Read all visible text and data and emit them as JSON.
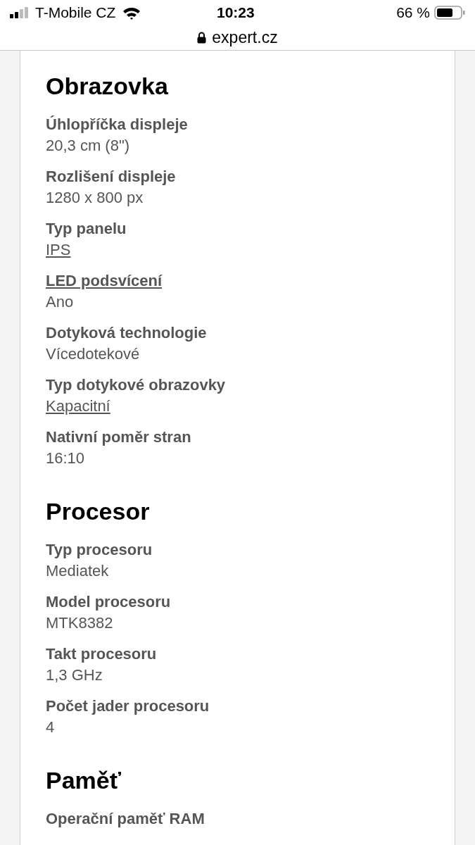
{
  "status_bar": {
    "carrier": "T-Mobile CZ",
    "time": "10:23",
    "battery": "66 %"
  },
  "address_bar": {
    "url": "expert.cz"
  },
  "sections": [
    {
      "title": "Obrazovka",
      "specs": [
        {
          "label": "Úhlopříčka displeje",
          "value": "20,3 cm (8\")",
          "label_link": false,
          "value_link": false
        },
        {
          "label": "Rozlišení displeje",
          "value": "1280 x 800 px",
          "label_link": false,
          "value_link": false
        },
        {
          "label": "Typ panelu",
          "value": "IPS",
          "label_link": false,
          "value_link": true
        },
        {
          "label": "LED podsvícení",
          "value": "Ano",
          "label_link": true,
          "value_link": false
        },
        {
          "label": "Dotyková technologie",
          "value": "Vícedotekové",
          "label_link": false,
          "value_link": false
        },
        {
          "label": "Typ dotykové obrazovky",
          "value": "Kapacitní",
          "label_link": false,
          "value_link": true
        },
        {
          "label": "Nativní poměr stran",
          "value": "16:10",
          "label_link": false,
          "value_link": false
        }
      ]
    },
    {
      "title": "Procesor",
      "specs": [
        {
          "label": "Typ procesoru",
          "value": "Mediatek",
          "label_link": false,
          "value_link": false
        },
        {
          "label": "Model procesoru",
          "value": "MTK8382",
          "label_link": false,
          "value_link": false
        },
        {
          "label": "Takt procesoru",
          "value": "1,3 GHz",
          "label_link": false,
          "value_link": false
        },
        {
          "label": "Počet jader procesoru",
          "value": "4",
          "label_link": false,
          "value_link": false
        }
      ]
    },
    {
      "title": "Paměť",
      "specs": [
        {
          "label": "Operační paměť RAM",
          "label_link": false
        }
      ]
    }
  ]
}
